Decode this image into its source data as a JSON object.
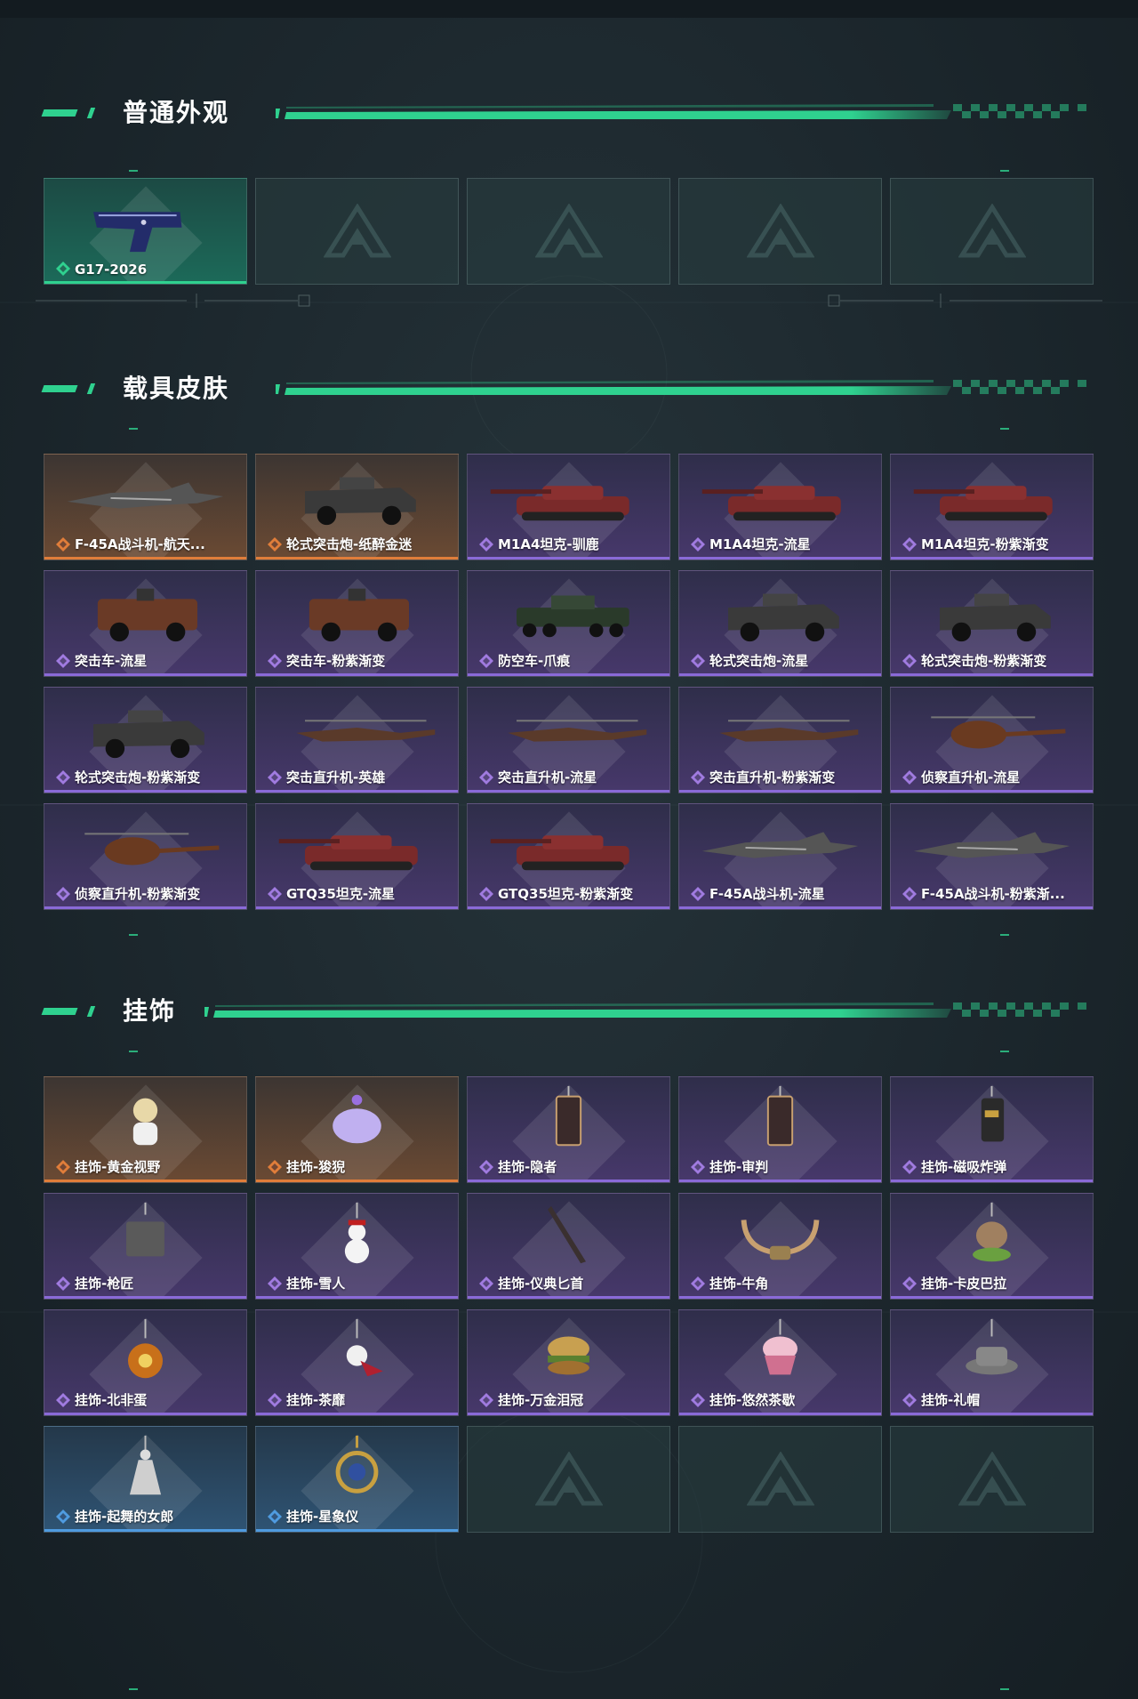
{
  "theme": {
    "accent": "#2fd18f",
    "purple": "#8a6ad8",
    "orange": "#e07d3a",
    "blue": "#4f9be0"
  },
  "sections": {
    "normal": {
      "title": "普通外观",
      "items": [
        {
          "label": "G17-2026",
          "rarity": "green",
          "icon": "pistol-icon"
        },
        {
          "label": "",
          "rarity": "empty"
        },
        {
          "label": "",
          "rarity": "empty"
        },
        {
          "label": "",
          "rarity": "empty"
        },
        {
          "label": "",
          "rarity": "empty"
        }
      ]
    },
    "vehicle": {
      "title": "载具皮肤",
      "items": [
        {
          "label": "F-45A战斗机-航天...",
          "rarity": "orange",
          "icon": "jet-icon"
        },
        {
          "label": "轮式突击炮-纸醉金迷",
          "rarity": "orange",
          "icon": "armored-car-icon"
        },
        {
          "label": "M1A4坦克-驯鹿",
          "rarity": "purple",
          "icon": "tank-icon"
        },
        {
          "label": "M1A4坦克-流星",
          "rarity": "purple",
          "icon": "tank-icon"
        },
        {
          "label": "M1A4坦克-粉紫渐变",
          "rarity": "purple",
          "icon": "tank-icon"
        },
        {
          "label": "突击车-流星",
          "rarity": "purple",
          "icon": "assault-vehicle-icon"
        },
        {
          "label": "突击车-粉紫渐变",
          "rarity": "purple",
          "icon": "assault-vehicle-icon"
        },
        {
          "label": "防空车-爪痕",
          "rarity": "purple",
          "icon": "aa-vehicle-icon"
        },
        {
          "label": "轮式突击炮-流星",
          "rarity": "purple",
          "icon": "armored-car-icon"
        },
        {
          "label": "轮式突击炮-粉紫渐变",
          "rarity": "purple",
          "icon": "armored-car-icon"
        },
        {
          "label": "轮式突击炮-粉紫渐变",
          "rarity": "purple",
          "icon": "armored-car-icon"
        },
        {
          "label": "突击直升机-英雄",
          "rarity": "purple",
          "icon": "helicopter-icon"
        },
        {
          "label": "突击直升机-流星",
          "rarity": "purple",
          "icon": "helicopter-icon"
        },
        {
          "label": "突击直升机-粉紫渐变",
          "rarity": "purple",
          "icon": "helicopter-icon"
        },
        {
          "label": "侦察直升机-流星",
          "rarity": "purple",
          "icon": "scout-helicopter-icon"
        },
        {
          "label": "侦察直升机-粉紫渐变",
          "rarity": "purple",
          "icon": "scout-helicopter-icon"
        },
        {
          "label": "GTQ35坦克-流星",
          "rarity": "purple",
          "icon": "tank-icon"
        },
        {
          "label": "GTQ35坦克-粉紫渐变",
          "rarity": "purple",
          "icon": "tank-icon"
        },
        {
          "label": "F-45A战斗机-流星",
          "rarity": "purple",
          "icon": "jet-icon"
        },
        {
          "label": "F-45A战斗机-粉紫渐...",
          "rarity": "purple",
          "icon": "jet-icon"
        }
      ]
    },
    "charm": {
      "title": "挂饰",
      "items": [
        {
          "label": "挂饰-黄金视野",
          "rarity": "orange",
          "icon": "charm-figure-icon"
        },
        {
          "label": "挂饰-狻猊",
          "rarity": "orange",
          "icon": "charm-creature-icon"
        },
        {
          "label": "挂饰-隐者",
          "rarity": "purple",
          "icon": "charm-card-icon"
        },
        {
          "label": "挂饰-审判",
          "rarity": "purple",
          "icon": "charm-card-icon"
        },
        {
          "label": "挂饰-磁吸炸弹",
          "rarity": "purple",
          "icon": "charm-bomb-icon"
        },
        {
          "label": "挂饰-枪匠",
          "rarity": "purple",
          "icon": "charm-box-icon"
        },
        {
          "label": "挂饰-雪人",
          "rarity": "purple",
          "icon": "charm-snowman-icon"
        },
        {
          "label": "挂饰-仪典匕首",
          "rarity": "purple",
          "icon": "charm-dagger-icon"
        },
        {
          "label": "挂饰-牛角",
          "rarity": "purple",
          "icon": "charm-horns-icon"
        },
        {
          "label": "挂饰-卡皮巴拉",
          "rarity": "purple",
          "icon": "charm-capybara-icon"
        },
        {
          "label": "挂饰-北非蛋",
          "rarity": "purple",
          "icon": "charm-plate-icon"
        },
        {
          "label": "挂饰-茶靡",
          "rarity": "purple",
          "icon": "charm-flower-icon"
        },
        {
          "label": "挂饰-万金泪冠",
          "rarity": "purple",
          "icon": "charm-burger-icon"
        },
        {
          "label": "挂饰-悠然茶歇",
          "rarity": "purple",
          "icon": "charm-cupcake-icon"
        },
        {
          "label": "挂饰-礼帽",
          "rarity": "purple",
          "icon": "charm-hat-icon"
        },
        {
          "label": "挂饰-起舞的女郎",
          "rarity": "blue",
          "icon": "charm-dancer-icon"
        },
        {
          "label": "挂饰-星象仪",
          "rarity": "blue",
          "icon": "charm-astrolabe-icon"
        },
        {
          "label": "",
          "rarity": "empty"
        },
        {
          "label": "",
          "rarity": "empty"
        },
        {
          "label": "",
          "rarity": "empty"
        }
      ]
    }
  }
}
